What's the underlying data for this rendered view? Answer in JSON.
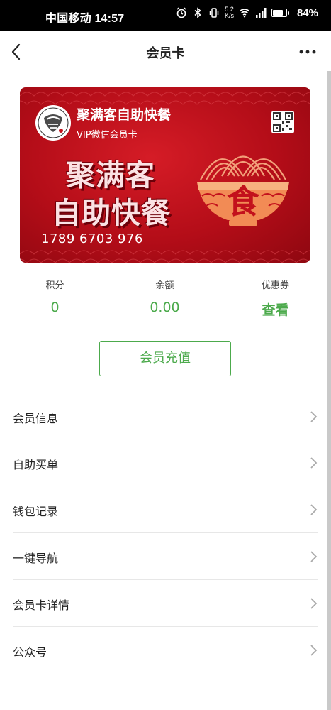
{
  "status_bar": {
    "carrier_time": "中国移动 14:57",
    "net_speed_value": "5.2",
    "net_speed_unit": "K/s",
    "battery_text": "84%",
    "battery_level": 0.84
  },
  "navbar": {
    "title": "会员卡"
  },
  "card": {
    "store_name": "聚满客自助快餐",
    "card_type": "VIP微信会员卡",
    "brand_line1": "聚满客",
    "brand_line2": "自助快餐",
    "bowl_char": "食",
    "card_number": "1789 6703 976",
    "colors": {
      "primary": "#c3111c",
      "text": "#ffffff"
    }
  },
  "stats": {
    "points_label": "积分",
    "points_value": "0",
    "balance_label": "余额",
    "balance_value": "0.00",
    "coupon_label": "优惠券",
    "coupon_value": "查看",
    "accent_color": "#4caa4c"
  },
  "recharge_button": "会员充值",
  "menu": {
    "items": [
      {
        "label": "会员信息"
      },
      {
        "label": "自助买单"
      },
      {
        "label": "钱包记录"
      },
      {
        "label": "一键导航"
      },
      {
        "label": "会员卡详情"
      },
      {
        "label": "公众号"
      }
    ]
  },
  "icons": [
    "back-arrow-icon",
    "more-icon",
    "qr-code-icon",
    "chevron-right-icon",
    "alarm-icon",
    "bluetooth-icon",
    "vibrate-icon",
    "wifi-icon",
    "signal-icon",
    "battery-icon"
  ]
}
